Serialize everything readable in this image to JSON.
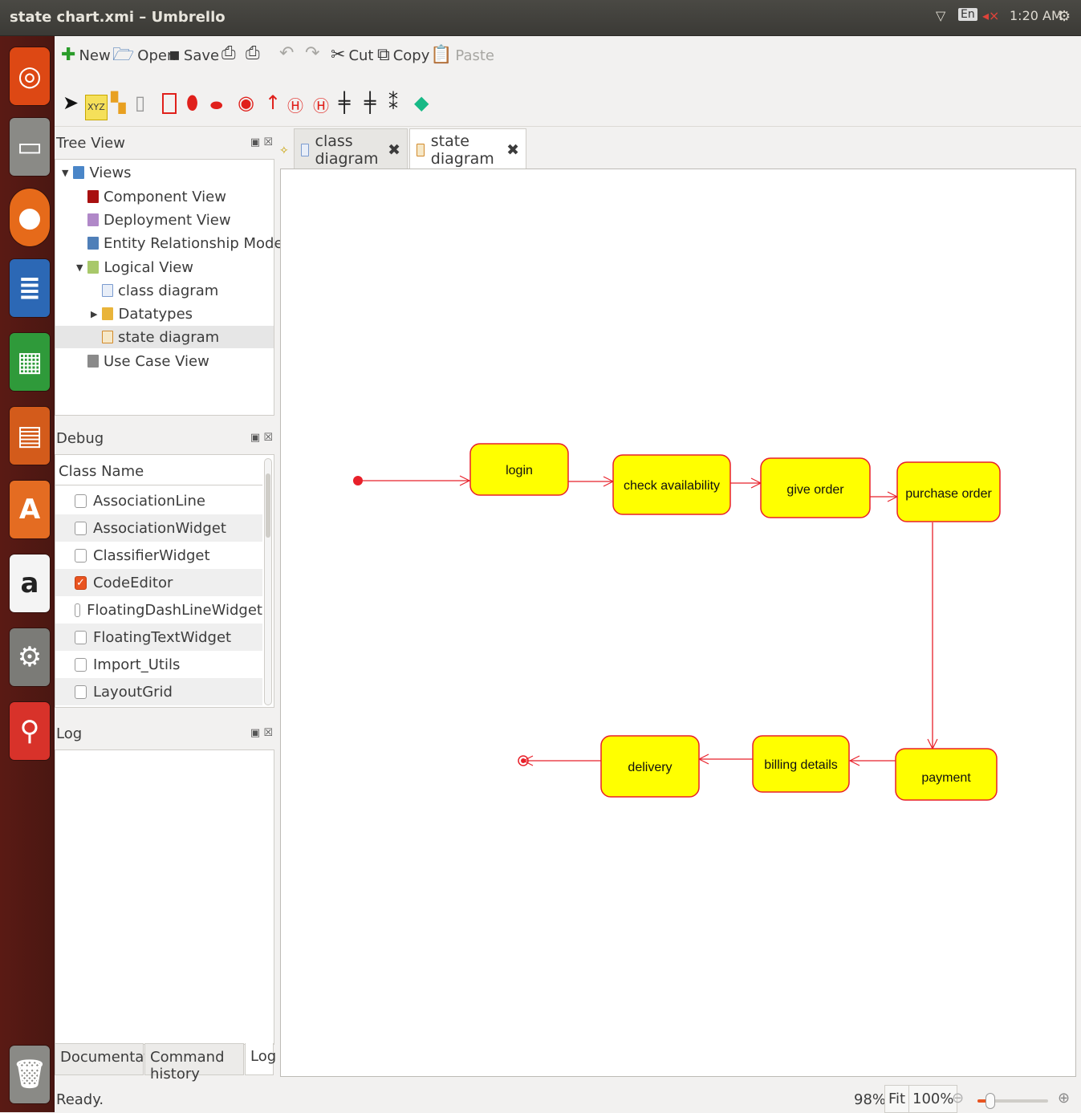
{
  "window": {
    "title": "state chart.xmi – Umbrello"
  },
  "indicators": {
    "keyboard": "En",
    "time": "1:20 AM"
  },
  "toolbar": {
    "new": "New",
    "open": "Open",
    "save": "Save",
    "cut": "Cut",
    "copy": "Copy",
    "paste": "Paste"
  },
  "tree": {
    "title": "Tree View",
    "items": [
      {
        "label": "Views"
      },
      {
        "label": "Component View"
      },
      {
        "label": "Deployment View"
      },
      {
        "label": "Entity Relationship Model"
      },
      {
        "label": "Logical View"
      },
      {
        "label": "class diagram"
      },
      {
        "label": "Datatypes"
      },
      {
        "label": "state diagram"
      },
      {
        "label": "Use Case View"
      }
    ]
  },
  "debug": {
    "title": "Debug",
    "column": "Class Name",
    "rows": [
      {
        "label": "AssociationLine",
        "checked": false
      },
      {
        "label": "AssociationWidget",
        "checked": false
      },
      {
        "label": "ClassifierWidget",
        "checked": false
      },
      {
        "label": "CodeEditor",
        "checked": true
      },
      {
        "label": "FloatingDashLineWidget",
        "checked": false
      },
      {
        "label": "FloatingTextWidget",
        "checked": false
      },
      {
        "label": "Import_Utils",
        "checked": false
      },
      {
        "label": "LayoutGrid",
        "checked": false
      }
    ]
  },
  "log": {
    "title": "Log"
  },
  "bottom_tabs": {
    "documentation": "Documentation",
    "command_history": "Command history",
    "log": "Log"
  },
  "tabs": {
    "class_diagram": "class diagram",
    "state_diagram": "state diagram"
  },
  "diagram": {
    "states": {
      "login": "login",
      "check_availability": "check availability",
      "give_order": "give order",
      "purchase_order": "purchase order",
      "payment": "payment",
      "billing_details": "billing details",
      "delivery": "delivery"
    },
    "colors": {
      "fill": "#ffff00",
      "line": "#e8202a"
    }
  },
  "status": {
    "text": "Ready.",
    "zoom": "98%",
    "fit": "Fit",
    "hundred": "100%"
  }
}
